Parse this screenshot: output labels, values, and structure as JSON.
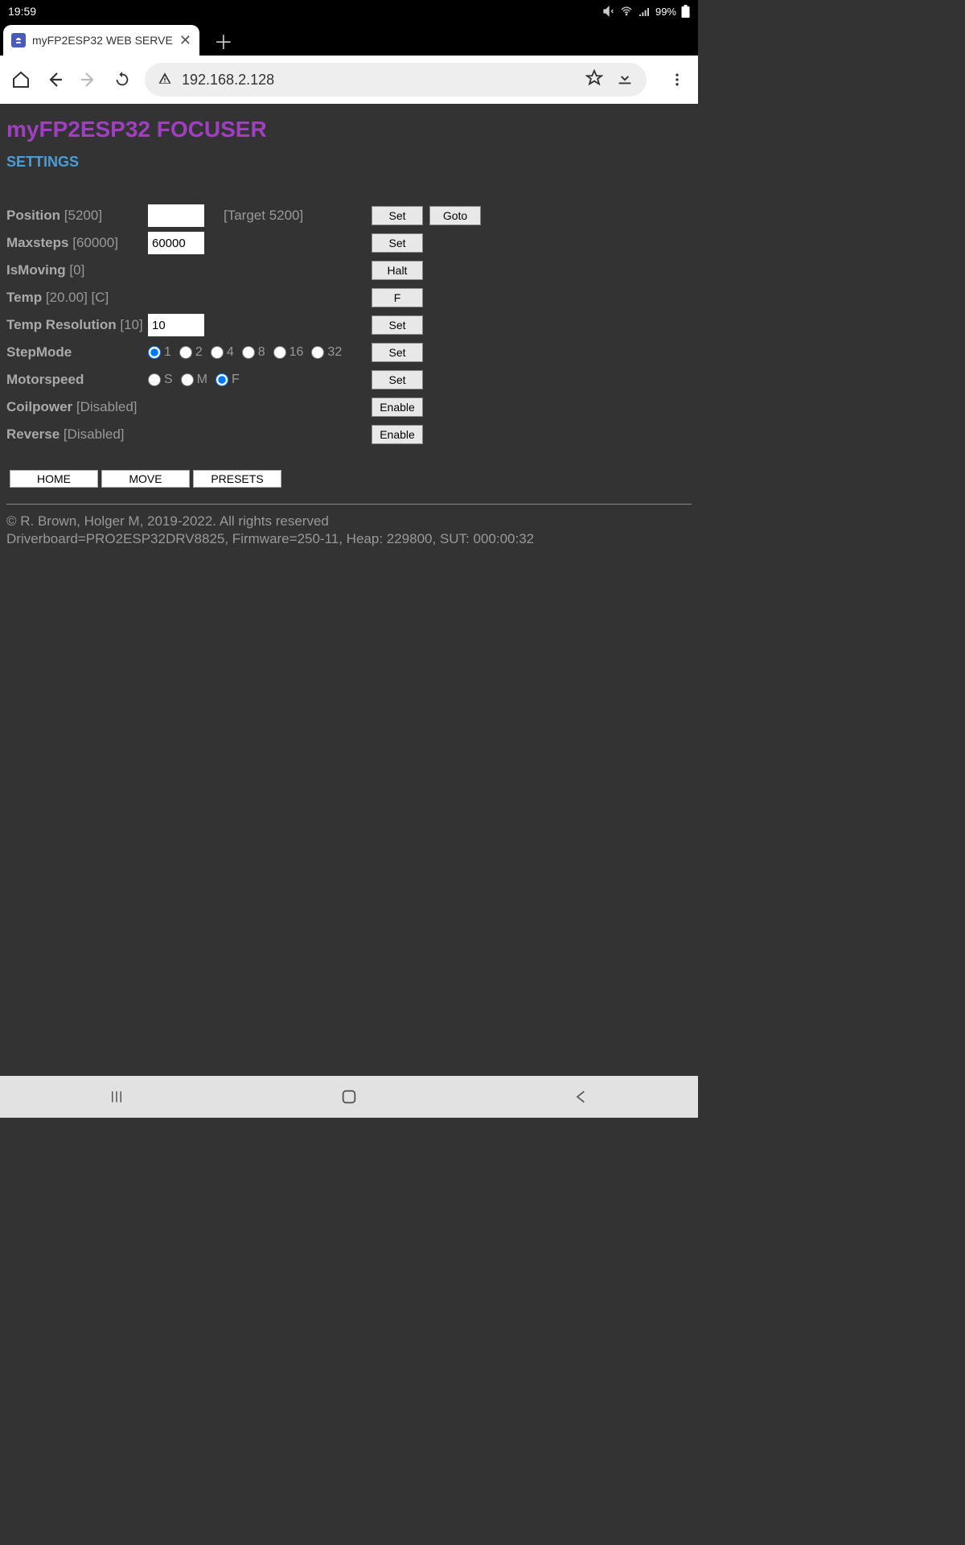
{
  "statusbar": {
    "time": "19:59",
    "battery": "99%"
  },
  "browser": {
    "tab_title": "myFP2ESP32 WEB SERVE",
    "url": "192.168.2.128"
  },
  "page": {
    "title": "myFP2ESP32 FOCUSER",
    "section": "SETTINGS"
  },
  "form": {
    "position": {
      "label": "Position",
      "value_bracket": "[5200]",
      "input": "",
      "target": "[Target 5200]",
      "btn1": "Set",
      "btn2": "Goto"
    },
    "maxsteps": {
      "label": "Maxsteps",
      "value_bracket": "[60000]",
      "input": "60000",
      "btn": "Set"
    },
    "ismoving": {
      "label": "IsMoving",
      "value_bracket": "[0]",
      "btn": "Halt"
    },
    "temp": {
      "label": "Temp",
      "value_bracket": "[20.00] [C]",
      "btn": "F"
    },
    "tempres": {
      "label": "Temp Resolution",
      "value_bracket": "[10]",
      "input": "10",
      "btn": "Set"
    },
    "stepmode": {
      "label": "StepMode",
      "options": [
        "1",
        "2",
        "4",
        "8",
        "16",
        "32"
      ],
      "selected": "1",
      "btn": "Set"
    },
    "motorspeed": {
      "label": "Motorspeed",
      "options": [
        "S",
        "M",
        "F"
      ],
      "selected": "F",
      "btn": "Set"
    },
    "coilpower": {
      "label": "Coilpower",
      "value_bracket": "[Disabled]",
      "btn": "Enable"
    },
    "reverse": {
      "label": "Reverse",
      "value_bracket": "[Disabled]",
      "btn": "Enable"
    }
  },
  "nav": {
    "home": "HOME",
    "move": "MOVE",
    "presets": "PRESETS"
  },
  "footer": {
    "line1": "© R. Brown, Holger M, 2019-2022. All rights reserved",
    "line2": "Driverboard=PRO2ESP32DRV8825, Firmware=250-11, Heap: 229800, SUT: 000:00:32"
  }
}
